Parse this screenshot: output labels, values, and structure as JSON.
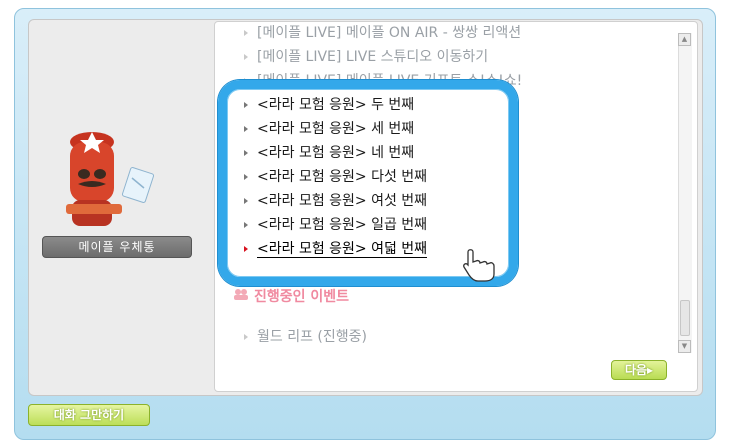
{
  "npc": {
    "name": "메이플 우체통"
  },
  "menu": {
    "items": [
      {
        "label": "[메이플 LIVE] 메이플 ON AIR - 쌍쌍 리액션",
        "state": "dim"
      },
      {
        "label": "[메이플 LIVE] LIVE 스튜디오 이동하기",
        "state": "dim"
      },
      {
        "label": "[메이플 LIVE] 메이플 LIVE 기프트 쇼!쇼!쇼!",
        "state": "dim"
      },
      {
        "label": "<라라 모험 응원> 두 번째",
        "state": "focus"
      },
      {
        "label": "<라라 모험 응원> 세 번째",
        "state": "focus"
      },
      {
        "label": "<라라 모험 응원> 네 번째",
        "state": "focus"
      },
      {
        "label": "<라라 모험 응원> 다섯 번째",
        "state": "focus"
      },
      {
        "label": "<라라 모험 응원> 여섯 번째",
        "state": "focus"
      },
      {
        "label": "<라라 모험 응원> 일곱 번째",
        "state": "focus"
      },
      {
        "label": "<라라 모험 응원> 여덟 번째",
        "state": "selected"
      }
    ],
    "event_heading": "진행중인 이벤트",
    "event_item": "월드 리프 (진행중)"
  },
  "buttons": {
    "next": "다음▸",
    "end_chat": "대화 그만하기"
  },
  "colors": {
    "highlight": "#33a8ea",
    "selected_bullet": "#d8121f",
    "frame": "#b4ddf0"
  }
}
